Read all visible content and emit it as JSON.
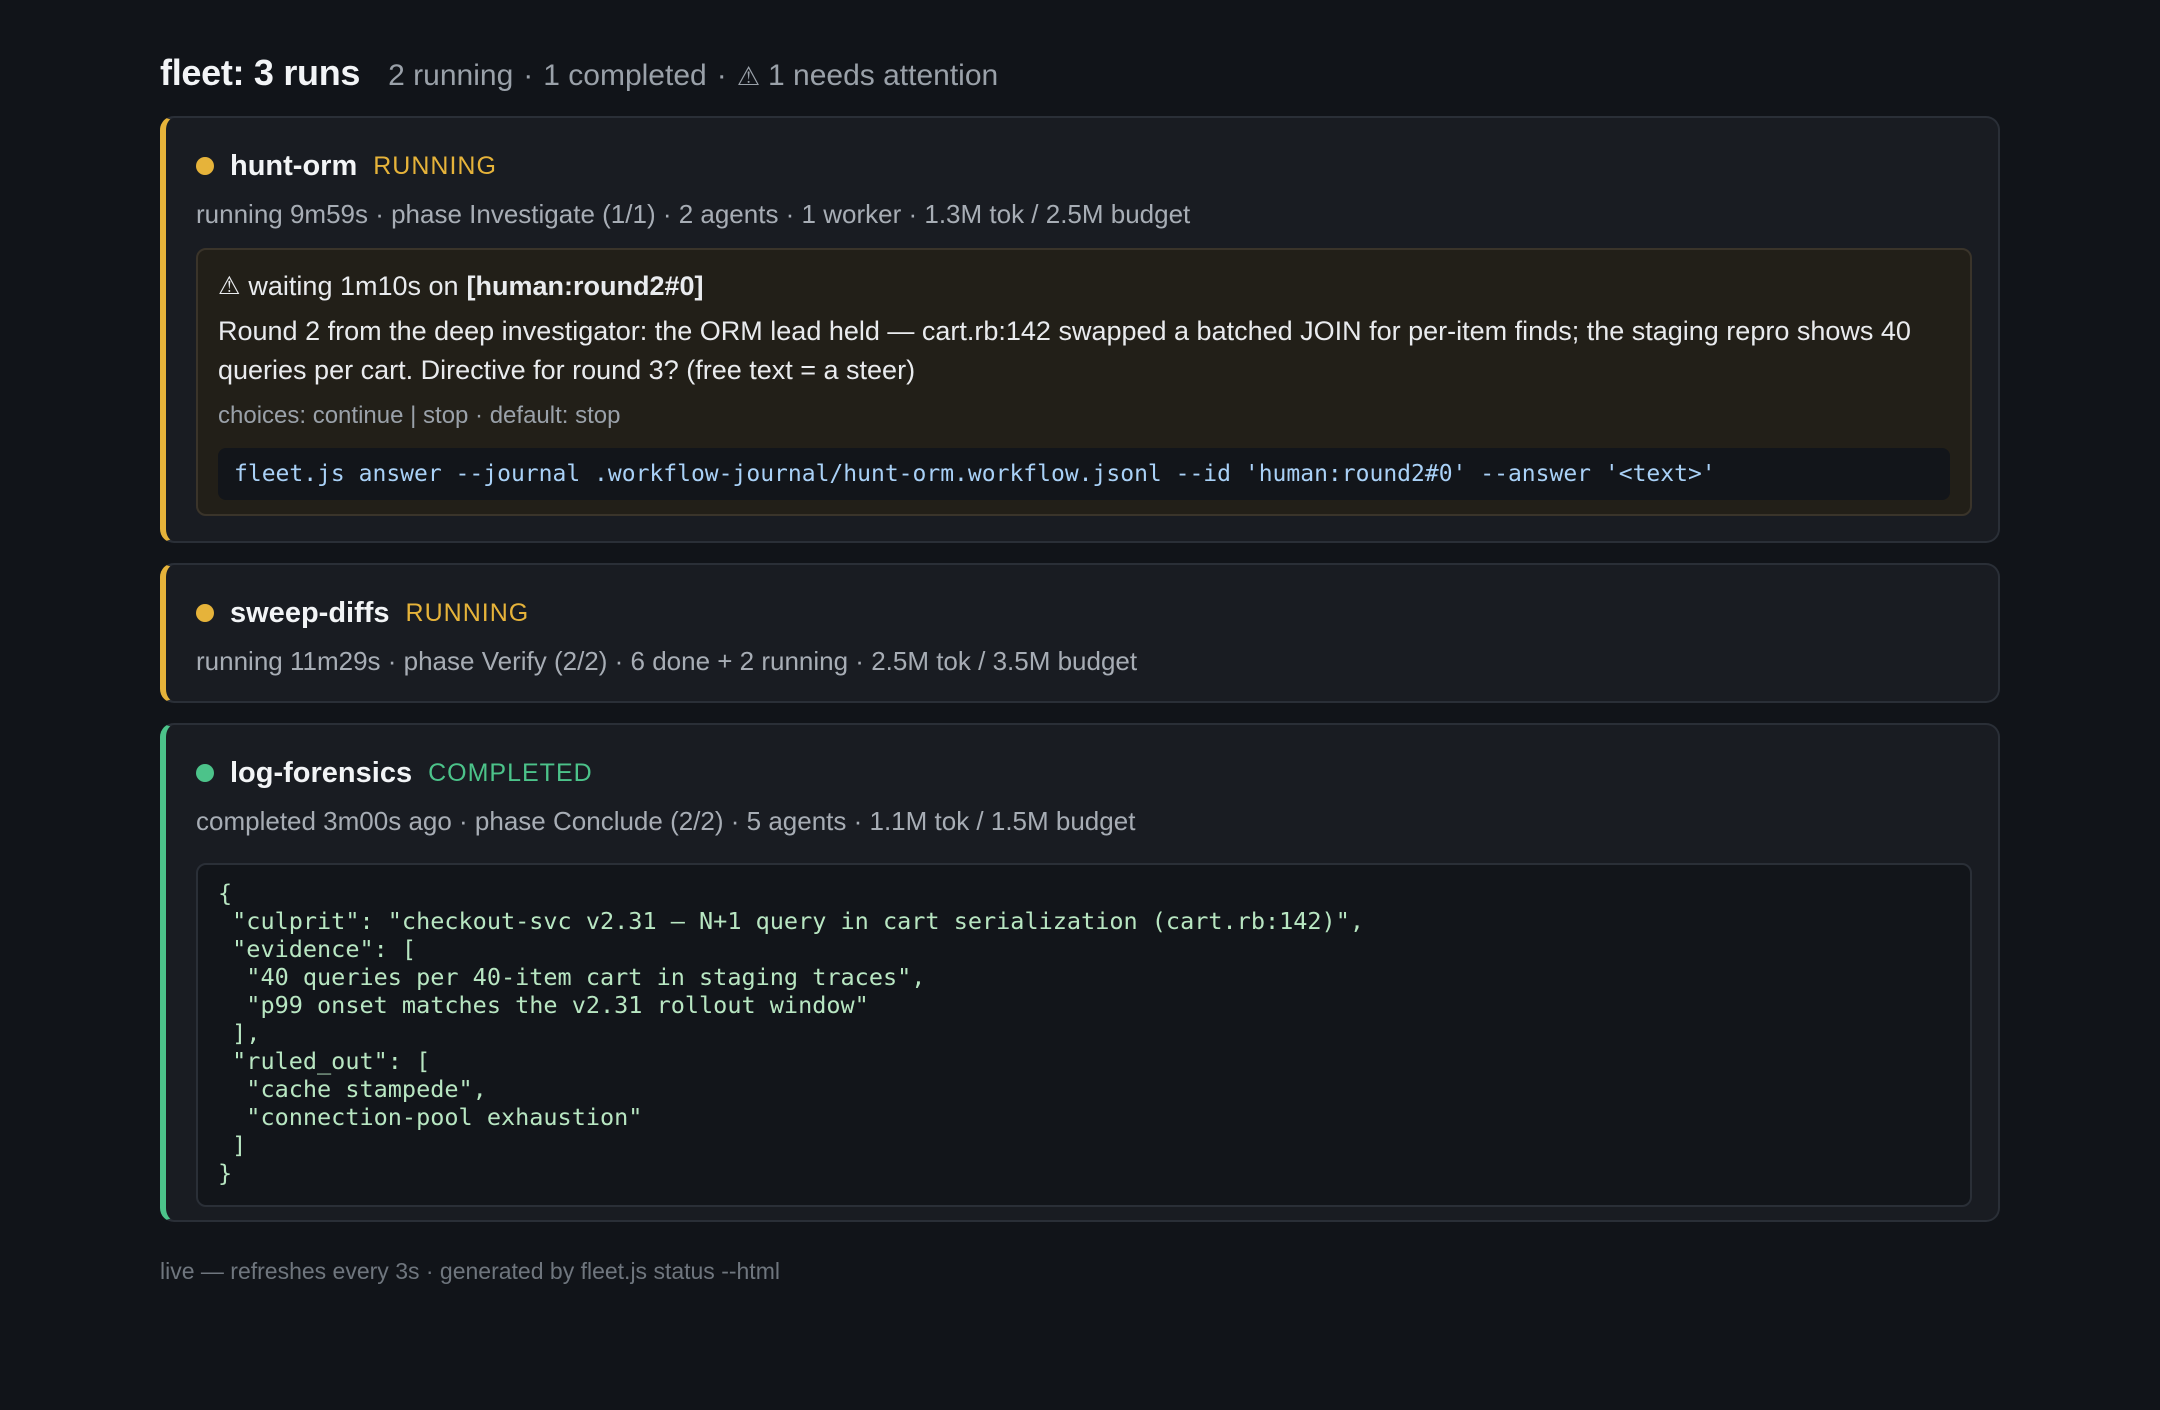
{
  "header": {
    "title": "fleet: 3 runs",
    "running": "2 running",
    "completed": "1 completed",
    "attention_icon": "warning-icon",
    "attention": "1 needs attention",
    "separator": "·"
  },
  "runs": [
    {
      "name": "hunt-orm",
      "state": "RUNNING",
      "status_color": "#e6b33a",
      "meta": "running 9m59s · phase Investigate (1/1) · 2 agents · 1 worker · 1.3M tok / 2.5M budget",
      "attention": {
        "icon": "warning-icon",
        "waiting_prefix": "waiting 1m10s on",
        "ref": "[human:round2#0]",
        "message": "Round 2 from the deep investigator: the ORM lead held — cart.rb:142 swapped a batched JOIN for per-item finds; the staging repro shows 40 queries per cart. Directive for round 3? (free text = a steer)",
        "choices": "choices: continue | stop · default: stop",
        "command": "fleet.js answer --journal .workflow-journal/hunt-orm.workflow.jsonl --id 'human:round2#0' --answer '<text>'"
      }
    },
    {
      "name": "sweep-diffs",
      "state": "RUNNING",
      "status_color": "#e6b33a",
      "meta": "running 11m29s · phase Verify (2/2) · 6 done + 2 running · 2.5M tok / 3.5M budget"
    },
    {
      "name": "log-forensics",
      "state": "COMPLETED",
      "status_color": "#4cc38a",
      "meta": "completed 3m00s ago · phase Conclude (2/2) · 5 agents · 1.1M tok / 1.5M budget",
      "result": "{\n \"culprit\": \"checkout-svc v2.31 — N+1 query in cart serialization (cart.rb:142)\",\n \"evidence\": [\n  \"40 queries per 40-item cart in staging traces\",\n  \"p99 onset matches the v2.31 rollout window\"\n ],\n \"ruled_out\": [\n  \"cache stampede\",\n  \"connection-pool exhaustion\"\n ]\n}"
    }
  ],
  "footer": "live — refreshes every 3s · generated by fleet.js status --html"
}
